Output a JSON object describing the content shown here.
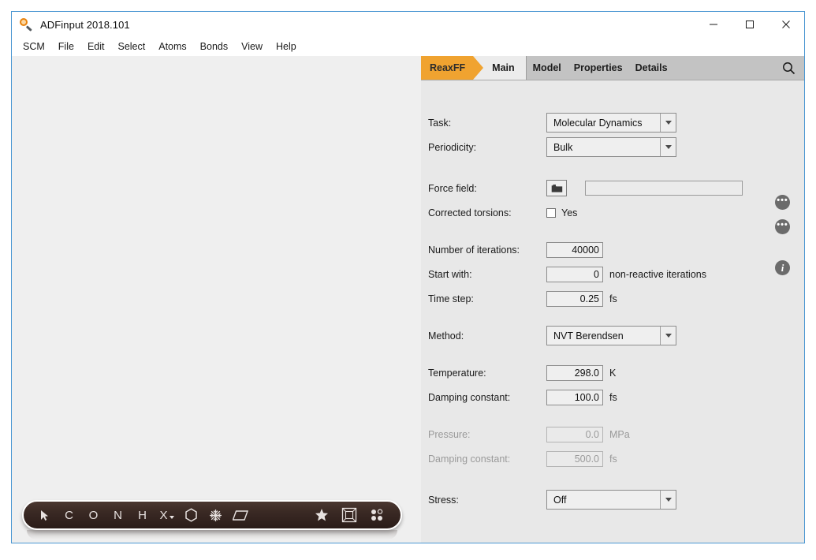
{
  "window": {
    "title": "ADFinput 2018.101",
    "app_icon": "magnifier-icon",
    "controls": {
      "minimize": "minimize-icon",
      "maximize": "maximize-icon",
      "close": "close-icon"
    },
    "border_color": "#4b97d2"
  },
  "menubar": {
    "items": [
      {
        "label": "SCM"
      },
      {
        "label": "File"
      },
      {
        "label": "Edit"
      },
      {
        "label": "Select"
      },
      {
        "label": "Atoms"
      },
      {
        "label": "Bonds"
      },
      {
        "label": "View"
      },
      {
        "label": "Help"
      }
    ]
  },
  "tabbar": {
    "badge": "ReaxFF",
    "badge_color": "#f0a330",
    "active_tab": "Main",
    "tabs": [
      {
        "label": "Model"
      },
      {
        "label": "Properties"
      },
      {
        "label": "Details"
      }
    ],
    "search_icon": "search-icon"
  },
  "form": {
    "task": {
      "label": "Task:",
      "value": "Molecular Dynamics",
      "more_icon": "ellipsis-icon"
    },
    "periodicity": {
      "label": "Periodicity:",
      "value": "Bulk",
      "more_icon": "ellipsis-icon"
    },
    "force_field": {
      "label": "Force field:",
      "value": "",
      "browse_icon": "folder-icon",
      "info_icon": "info-icon"
    },
    "corrected_torsions": {
      "label": "Corrected torsions:",
      "checkbox_label": "Yes",
      "checked": false
    },
    "iterations": {
      "label": "Number of iterations:",
      "value": "40000"
    },
    "start_with": {
      "label": "Start with:",
      "value": "0",
      "unit": "non-reactive iterations"
    },
    "time_step": {
      "label": "Time step:",
      "value": "0.25",
      "unit": "fs"
    },
    "method": {
      "label": "Method:",
      "value": "NVT Berendsen"
    },
    "temperature": {
      "label": "Temperature:",
      "value": "298.0",
      "unit": "K"
    },
    "temp_damping": {
      "label": "Damping constant:",
      "value": "100.0",
      "unit": "fs"
    },
    "pressure": {
      "label": "Pressure:",
      "value": "0.0",
      "unit": "MPa",
      "disabled": true
    },
    "pressure_damping": {
      "label": "Damping constant:",
      "value": "500.0",
      "unit": "fs",
      "disabled": true
    },
    "stress": {
      "label": "Stress:",
      "value": "Off"
    }
  },
  "mol_toolbar": {
    "tools": [
      {
        "name": "select-arrow-icon",
        "label": "◤"
      },
      {
        "name": "carbon-atom-tool",
        "label": "C"
      },
      {
        "name": "oxygen-atom-tool",
        "label": "O"
      },
      {
        "name": "nitrogen-atom-tool",
        "label": "N"
      },
      {
        "name": "hydrogen-atom-tool",
        "label": "H"
      },
      {
        "name": "other-element-tool",
        "label": "X"
      },
      {
        "name": "benzene-ring-tool",
        "label": "⬡"
      },
      {
        "name": "snowflake-tool",
        "label": "❅"
      },
      {
        "name": "plane-tool",
        "label": "▱"
      }
    ],
    "right_tools": [
      {
        "name": "favorites-star-icon",
        "label": "★"
      },
      {
        "name": "lattice-cube-icon",
        "label": "▣"
      },
      {
        "name": "dot-grid-icon",
        "label": "dots"
      }
    ]
  }
}
